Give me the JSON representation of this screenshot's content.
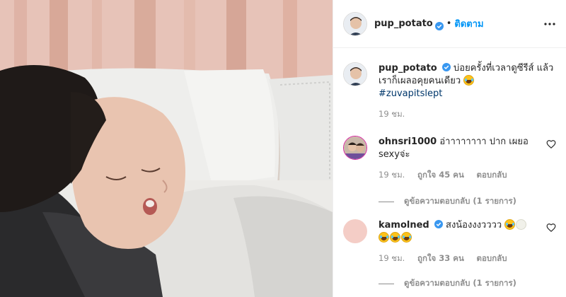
{
  "post": {
    "author": "pup_potato",
    "follow_label": "ติดตาม",
    "caption": {
      "username": "pup_potato",
      "text": "บ่อยครั้งที่เวลาดูซีรีส์ แล้วเราก็เผลอคุยคนเดียว",
      "hashtag": "#zuvapitslept",
      "time": "19 ชม."
    },
    "comments": [
      {
        "username": "ohnsri1000",
        "text": "อ่าาาาาาาา ปาก เผยอ sexyจ่ะ",
        "time": "19 ชม.",
        "likes": "ถูกใจ 45 คน",
        "reply_label": "ตอบกลับ",
        "view_replies": "ดูข้อความตอบกลับ (1 รายการ)"
      },
      {
        "username": "kamolned",
        "text": "สงน้องงงวววว",
        "time": "19 ชม.",
        "likes": "ถูกใจ 33 คน",
        "reply_label": "ตอบกลับ",
        "view_replies": "ดูข้อความตอบกลับ (1 รายการ)"
      }
    ]
  },
  "icons": {
    "verified": "verified-badge-icon",
    "more": "more-options-icon",
    "heart": "heart-outline-icon"
  },
  "colors": {
    "link_blue": "#0095f6",
    "hashtag": "#00376b",
    "meta_gray": "#8e8e8e",
    "verified_blue": "#3897f0"
  }
}
